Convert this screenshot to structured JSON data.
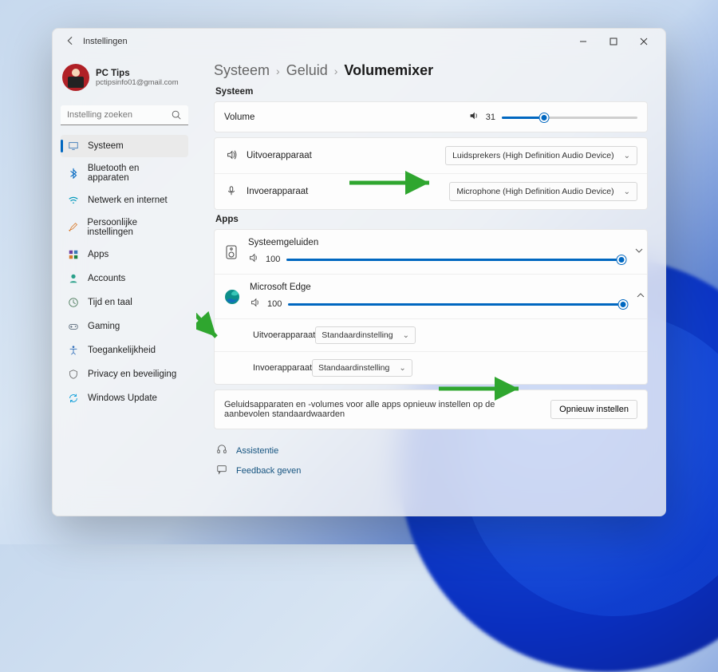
{
  "titlebar": {
    "title": "Instellingen"
  },
  "profile": {
    "name": "PC Tips",
    "email": "pctipsinfo01@gmail.com"
  },
  "search": {
    "placeholder": "Instelling zoeken"
  },
  "nav": [
    {
      "label": "Systeem",
      "icon": "display",
      "active": true
    },
    {
      "label": "Bluetooth en apparaten",
      "icon": "bluetooth"
    },
    {
      "label": "Netwerk en internet",
      "icon": "wifi"
    },
    {
      "label": "Persoonlijke instellingen",
      "icon": "brush"
    },
    {
      "label": "Apps",
      "icon": "apps"
    },
    {
      "label": "Accounts",
      "icon": "person"
    },
    {
      "label": "Tijd en taal",
      "icon": "clock"
    },
    {
      "label": "Gaming",
      "icon": "game"
    },
    {
      "label": "Toegankelijkheid",
      "icon": "access"
    },
    {
      "label": "Privacy en beveiliging",
      "icon": "shield"
    },
    {
      "label": "Windows Update",
      "icon": "update"
    }
  ],
  "breadcrumbs": {
    "level1": "Systeem",
    "level2": "Geluid",
    "current": "Volumemixer"
  },
  "sections": {
    "system": "Systeem",
    "apps": "Apps"
  },
  "system": {
    "volume_label": "Volume",
    "volume_value": 31,
    "output_label": "Uitvoerapparaat",
    "output_value": "Luidsprekers (High Definition Audio Device)",
    "input_label": "Invoerapparaat",
    "input_value": "Microphone (High Definition Audio Device)"
  },
  "apps": {
    "sys_sounds": {
      "name": "Systeemgeluiden",
      "volume": 100
    },
    "edge": {
      "name": "Microsoft Edge",
      "volume": 100,
      "output_label": "Uitvoerapparaat",
      "output_value": "Standaardinstelling",
      "input_label": "Invoerapparaat",
      "input_value": "Standaardinstelling"
    }
  },
  "reset": {
    "text": "Geluidsapparaten en -volumes voor alle apps opnieuw instellen op de aanbevolen standaardwaarden",
    "button": "Opnieuw instellen"
  },
  "help": {
    "assist": "Assistentie",
    "feedback": "Feedback geven"
  }
}
